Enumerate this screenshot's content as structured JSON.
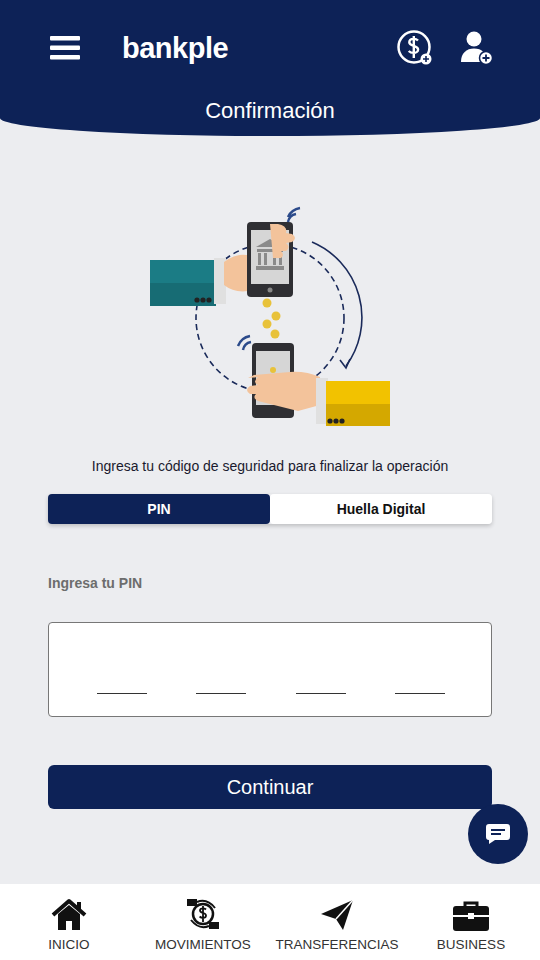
{
  "header": {
    "logo": "bankple",
    "title": "Confirmación"
  },
  "instruction": "Ingresa tu código de seguridad para finalizar la operación",
  "tabs": [
    {
      "label": "PIN",
      "selected": true
    },
    {
      "label": "Huella Digital",
      "selected": false
    }
  ],
  "pin": {
    "label": "Ingresa tu PIN",
    "slots": [
      {
        "filled": false
      },
      {
        "filled": false
      },
      {
        "filled": false
      },
      {
        "filled": false
      }
    ]
  },
  "button": "Continuar",
  "bottom_nav": [
    {
      "label": "INICIO",
      "selected": false
    },
    {
      "label": "MOVIMIENTOS",
      "selected": false
    },
    {
      "label": "TRANSFERENCIAS",
      "selected": false
    },
    {
      "label": "BUSINESS",
      "selected": false
    }
  ]
}
